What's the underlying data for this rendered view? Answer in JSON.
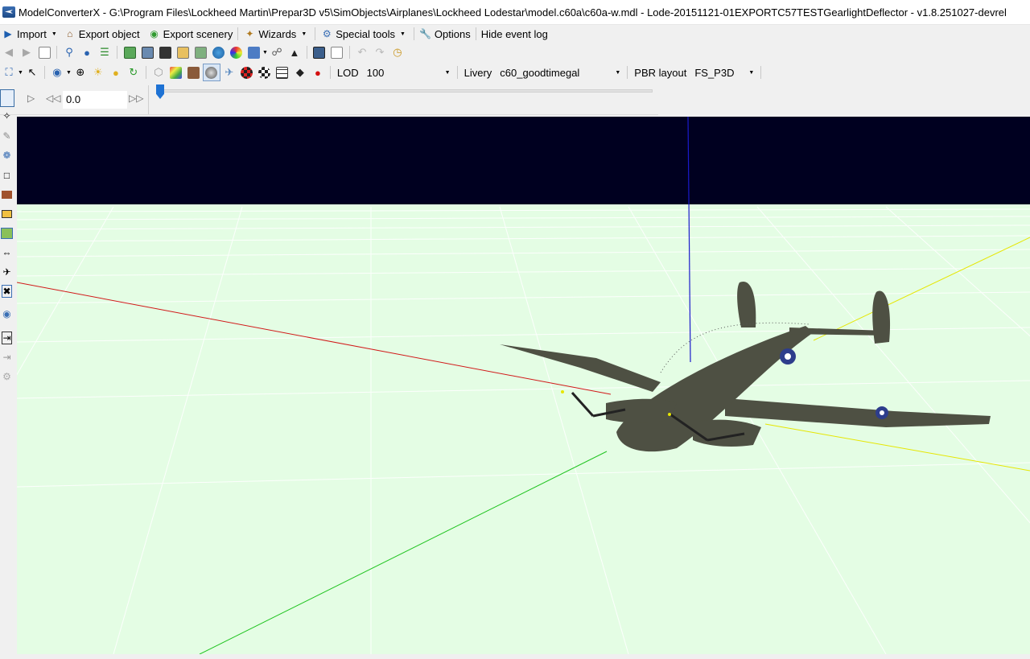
{
  "window": {
    "title": "ModelConverterX - G:\\Program Files\\Lockheed Martin\\Prepar3D v5\\SimObjects\\Airplanes\\Lockheed Lodestar\\model.c60a\\c60a-w.mdl - Lode-20151121-01EXPORTC57TESTGearlightDeflector - v1.8.251027-devrel"
  },
  "menu": {
    "import": "Import",
    "export_object": "Export object",
    "export_scenery": "Export scenery",
    "wizards": "Wizards",
    "special_tools": "Special tools",
    "options": "Options",
    "hide_event_log": "Hide event log"
  },
  "toolbar2": {
    "lod_label": "LOD",
    "lod_value": "100",
    "livery_label": "Livery",
    "livery_value": "c60_goodtimegal",
    "pbr_label": "PBR layout",
    "pbr_value": "FS_P3D"
  },
  "animation": {
    "time_value": "0.0",
    "position": 0.0
  },
  "colors": {
    "sky": "#000020",
    "ground": "#e4fde4",
    "x_axis": "#d11919",
    "y_axis": "#1a1acb",
    "z_axis": "#21c421",
    "yellow_axis": "#e6e600",
    "aircraft_olive": "#4e5043",
    "roundel_blue": "#2d3d8c"
  },
  "icons": {
    "titlebar": "app-icon",
    "import": "import-icon",
    "export_object": "home-icon",
    "export_scenery": "globe-icon",
    "wizards": "wand-icon",
    "special_tools": "gear-icon",
    "options": "wrench-icon"
  }
}
